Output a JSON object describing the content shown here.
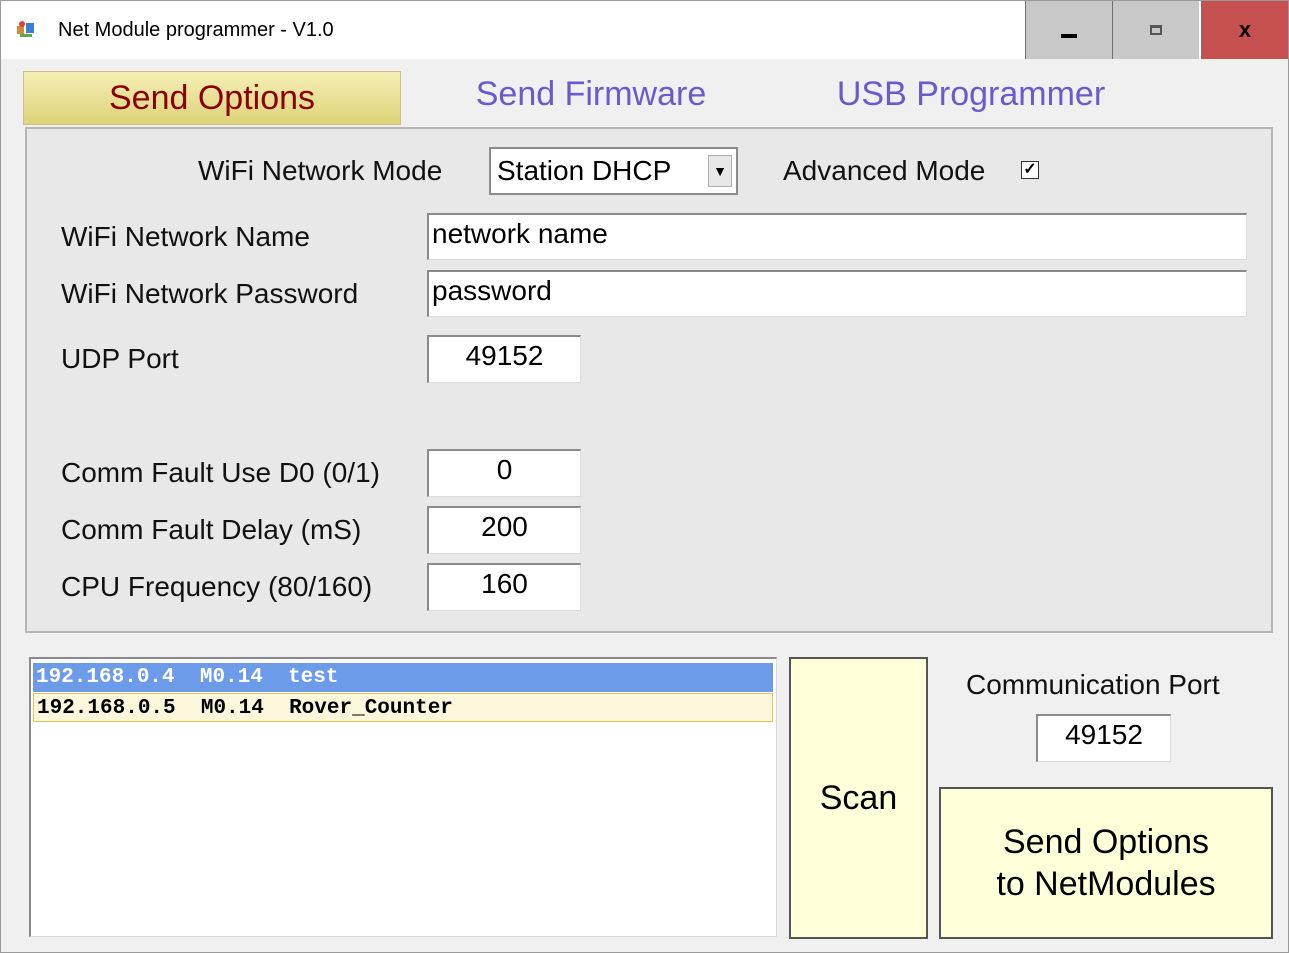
{
  "window": {
    "title": "Net Module programmer - V1.0",
    "close_label": "x"
  },
  "tabs": [
    {
      "label": "Send Options",
      "active": true
    },
    {
      "label": "Send Firmware",
      "active": false
    },
    {
      "label": "USB Programmer",
      "active": false
    }
  ],
  "options": {
    "wifi_mode_label": "WiFi Network Mode",
    "wifi_mode_value": "Station DHCP",
    "advanced_mode_label": "Advanced Mode",
    "advanced_mode_checked": true,
    "check_glyph": "✓",
    "network_name_label": "WiFi Network Name",
    "network_name_value": "network name",
    "network_password_label": "WiFi Network Password",
    "network_password_value": "password",
    "udp_port_label": "UDP Port",
    "udp_port_value": "49152",
    "comm_fault_d0_label": "Comm Fault Use D0 (0/1)",
    "comm_fault_d0_value": "0",
    "comm_fault_delay_label": "Comm Fault Delay (mS)",
    "comm_fault_delay_value": "200",
    "cpu_freq_label": "CPU Frequency (80/160)",
    "cpu_freq_value": "160"
  },
  "device_list": [
    {
      "ip": "192.168.0.4",
      "version": "M0.14",
      "name": "test",
      "selected": true
    },
    {
      "ip": "192.168.0.5",
      "version": "M0.14",
      "name": "Rover_Counter",
      "selected": false
    }
  ],
  "actions": {
    "scan_label": "Scan",
    "comm_port_label": "Communication Port",
    "comm_port_value": "49152",
    "send_line1": "Send Options",
    "send_line2": "to NetModules"
  },
  "colors": {
    "active_tab_text": "#8b0000",
    "inactive_tab_text": "#6a5acd",
    "selection": "#6c9bea",
    "button_fill": "#ffffd9",
    "close_button": "#c75050"
  }
}
